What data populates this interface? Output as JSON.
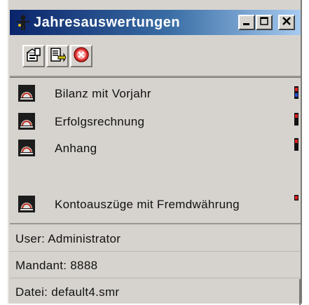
{
  "window": {
    "title": "Jahresauswertungen",
    "controls": [
      "minimize-icon",
      "maximize-icon",
      "close-icon"
    ]
  },
  "toolbar": {
    "buttons": [
      {
        "icon": "properties-icon"
      },
      {
        "icon": "export-icon"
      },
      {
        "icon": "stop-icon"
      }
    ]
  },
  "reports": [
    {
      "label": "Bilanz mit Vorjahr",
      "status": "traffic-light-red-blue"
    },
    {
      "label": "Erfolgsrechnung",
      "status": "traffic-light-red"
    },
    {
      "label": "Anhang",
      "status": "traffic-light-red"
    },
    {
      "label": "Kontoauszüge mit Fremdwährung",
      "status": "indicator-red"
    }
  ],
  "info": {
    "user": "User: Administrator",
    "mandant": "Mandant: 8888",
    "datei": "Datei: default4.smr"
  },
  "colors": {
    "titlebar_start": "#0a246a",
    "titlebar_end": "#a6caf0",
    "window_bg": "#d6d3ce",
    "status_red": "#e02020",
    "status_blue": "#2a4dd0"
  }
}
